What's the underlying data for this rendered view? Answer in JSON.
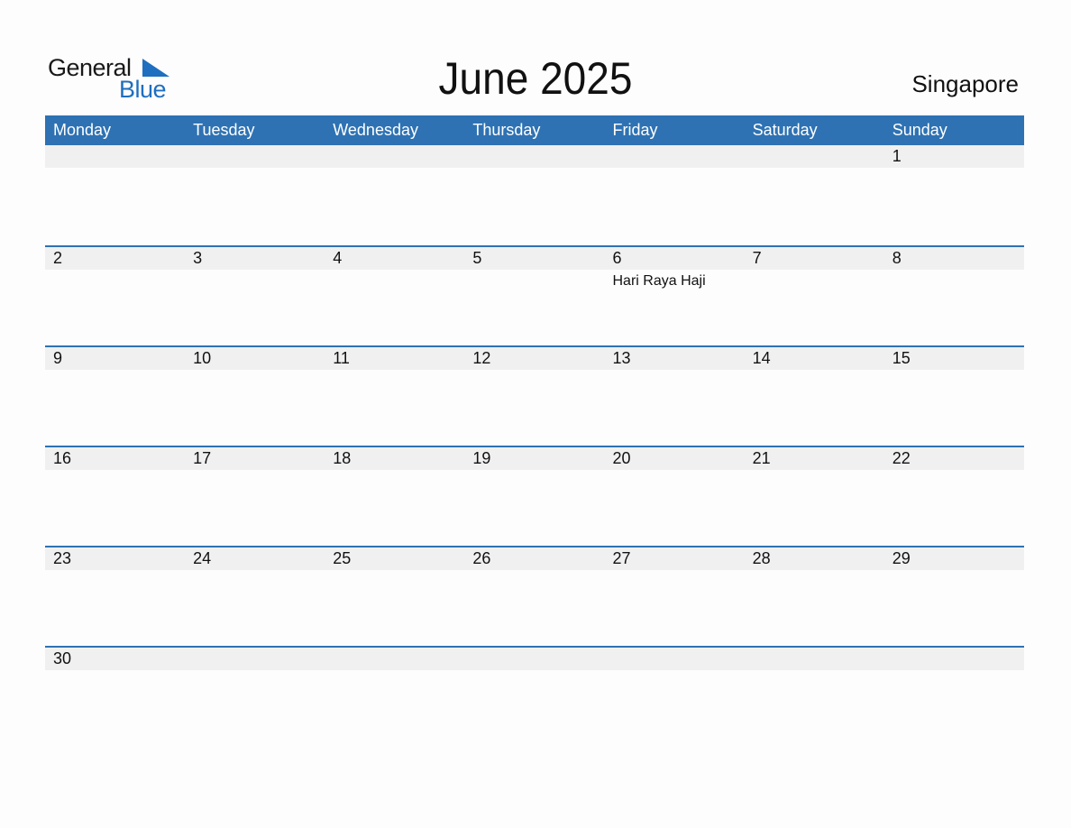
{
  "logo": {
    "word1": "General",
    "word2": "Blue"
  },
  "title": "June 2025",
  "country": "Singapore",
  "colors": {
    "accent": "#2e72b3",
    "band": "#f0f0f0"
  },
  "weekdays": [
    "Monday",
    "Tuesday",
    "Wednesday",
    "Thursday",
    "Friday",
    "Saturday",
    "Sunday"
  ],
  "weeks": [
    {
      "days": [
        "",
        "",
        "",
        "",
        "",
        "",
        "1"
      ],
      "events": [
        "",
        "",
        "",
        "",
        "",
        "",
        ""
      ]
    },
    {
      "days": [
        "2",
        "3",
        "4",
        "5",
        "6",
        "7",
        "8"
      ],
      "events": [
        "",
        "",
        "",
        "",
        "Hari Raya Haji",
        "",
        ""
      ]
    },
    {
      "days": [
        "9",
        "10",
        "11",
        "12",
        "13",
        "14",
        "15"
      ],
      "events": [
        "",
        "",
        "",
        "",
        "",
        "",
        ""
      ]
    },
    {
      "days": [
        "16",
        "17",
        "18",
        "19",
        "20",
        "21",
        "22"
      ],
      "events": [
        "",
        "",
        "",
        "",
        "",
        "",
        ""
      ]
    },
    {
      "days": [
        "23",
        "24",
        "25",
        "26",
        "27",
        "28",
        "29"
      ],
      "events": [
        "",
        "",
        "",
        "",
        "",
        "",
        ""
      ]
    },
    {
      "days": [
        "30",
        "",
        "",
        "",
        "",
        "",
        ""
      ],
      "events": [
        "",
        "",
        "",
        "",
        "",
        "",
        ""
      ]
    }
  ]
}
